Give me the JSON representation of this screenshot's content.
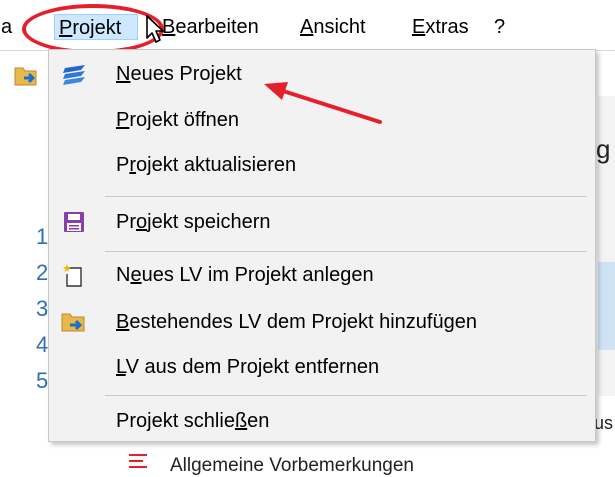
{
  "menubar": {
    "partial_label": "a",
    "projekt": {
      "underline": "P",
      "rest": "rojekt"
    },
    "bearbeiten": {
      "underline": "B",
      "rest": "earbeiten"
    },
    "ansicht": {
      "underline": "A",
      "rest": "nsicht"
    },
    "extras": {
      "underline": "E",
      "rest": "xtras"
    },
    "help": "?"
  },
  "dropdown": {
    "items": [
      {
        "pre": "",
        "u": "N",
        "post": "eues Projekt",
        "icon": "layers-icon"
      },
      {
        "pre": "",
        "u": "P",
        "post": "rojekt öffnen",
        "icon": ""
      },
      {
        "pre": "P",
        "u": "r",
        "post": "ojekt aktualisieren",
        "icon": ""
      },
      {
        "pre": "Pr",
        "u": "o",
        "post": "jekt speichern",
        "icon": "save-icon"
      },
      {
        "pre": "N",
        "u": "e",
        "post": "ues LV im Projekt anlegen",
        "icon": "new-document-icon"
      },
      {
        "pre": "",
        "u": "B",
        "post": "estehendes LV dem Projekt hinzufügen",
        "icon": "folder-add-icon"
      },
      {
        "pre": "",
        "u": "L",
        "post": "V aus dem Projekt entfernen",
        "icon": ""
      },
      {
        "pre": "Projekt schlie",
        "u": "ß",
        "post": "en",
        "icon": ""
      }
    ]
  },
  "background": {
    "numbers": [
      "1",
      "2",
      "3",
      "4",
      "5"
    ],
    "right_letter": "g",
    "right_bottom": "us",
    "bottom_text": "Allgemeine Vorbemerkungen"
  },
  "colors": {
    "annotation_red": "#e5202a",
    "menu_highlight": "#cde8ff",
    "number_blue": "#2f6fb3"
  }
}
